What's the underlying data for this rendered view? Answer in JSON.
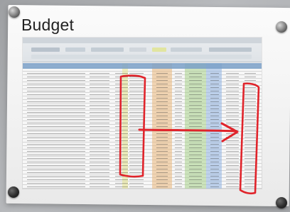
{
  "sign": {
    "title": "Budget"
  },
  "colors": {
    "annotation_red": "#e0242b",
    "header_blue": "#7aa0c8",
    "orange_band": "#e9b67a",
    "green_band": "#a7d18a",
    "blue_band": "#8fb3e2",
    "yellow_band": "#e7e58e"
  },
  "objects": [
    "wall-mounted-sign",
    "printed-spreadsheet",
    "red-highlight-box-left",
    "red-highlight-box-right",
    "red-arrow"
  ]
}
